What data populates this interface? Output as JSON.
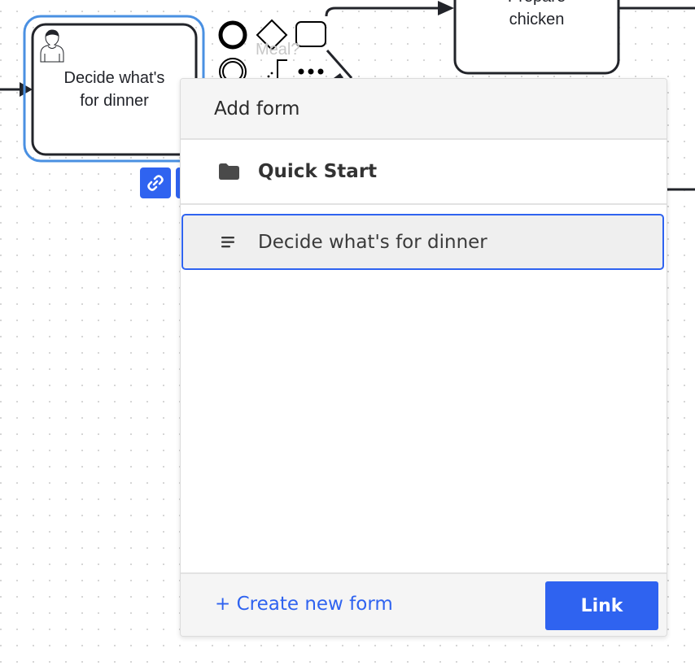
{
  "canvas": {
    "tasks": [
      {
        "id": "task-decide",
        "label_line1": "Decide what's",
        "label_line2": "for dinner",
        "type": "user-task",
        "selected": true
      },
      {
        "id": "task-prepare",
        "label_line1": "Prepare",
        "label_line2": "chicken",
        "type": "task",
        "selected": false
      }
    ],
    "context_pad": {
      "palette_icons": [
        "start-event-icon",
        "gateway-icon",
        "task-icon",
        "intermediate-event-icon",
        "text-annotation-icon",
        "more-icon",
        "connect-icon"
      ],
      "hidden_label": "Meal?"
    },
    "context_buttons": [
      {
        "name": "link-form-button",
        "icon": "link-icon"
      }
    ],
    "colors": {
      "selection": "#4a90e2",
      "stroke": "#22242a",
      "accent": "#2f63f0"
    }
  },
  "popup": {
    "title": "Add form",
    "folders": [
      {
        "label": "Quick Start",
        "icon": "folder-icon"
      }
    ],
    "forms": [
      {
        "label": "Decide what's for dinner",
        "icon": "form-icon",
        "selected": true
      }
    ],
    "footer": {
      "create_label": "+ Create new form",
      "link_label": "Link"
    }
  }
}
